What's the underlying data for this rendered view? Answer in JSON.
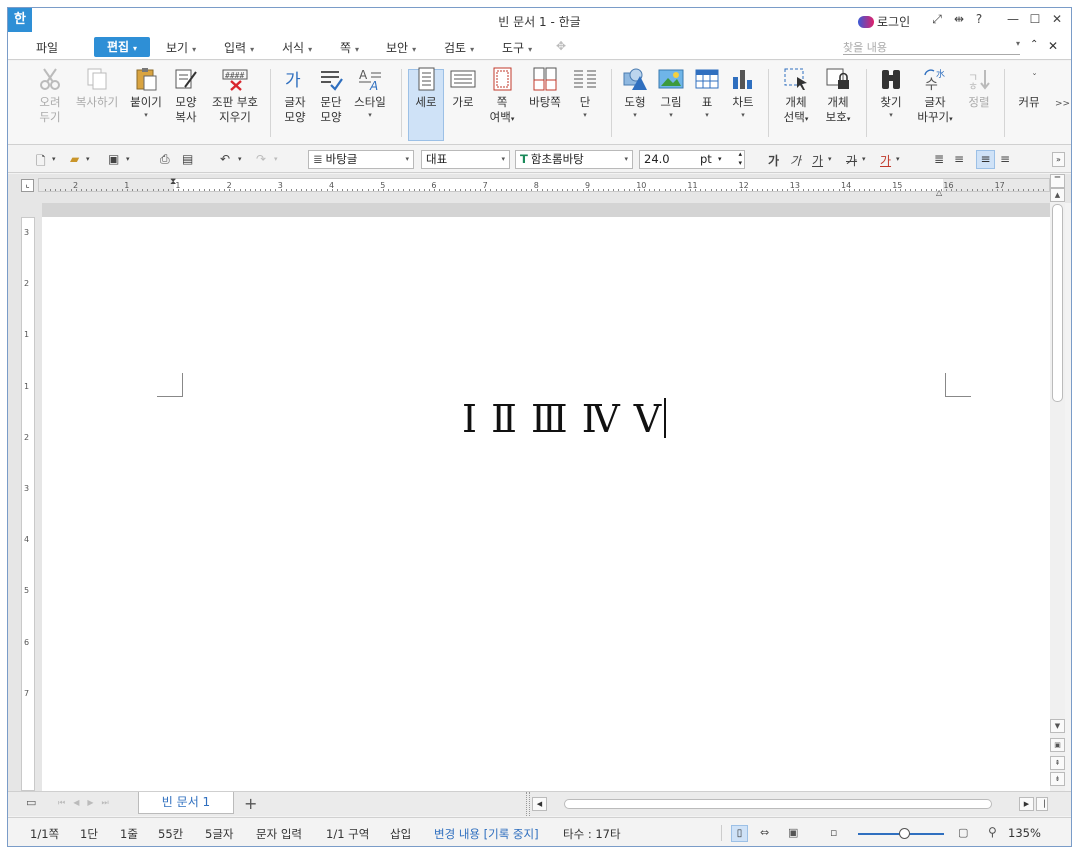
{
  "titlebar": {
    "logo": "한",
    "title": "빈 문서 1 - 한글",
    "login": "로그인",
    "help": "?"
  },
  "menubar": {
    "items": [
      "파일",
      "편집",
      "보기",
      "입력",
      "서식",
      "쪽",
      "보안",
      "검토",
      "도구"
    ],
    "active": "편집",
    "find_placeholder": "찾을 내용"
  },
  "ribbon": {
    "cut": [
      "오려",
      "두기"
    ],
    "copy": "복사하기",
    "paste": "붙이기",
    "format_copy": [
      "모양",
      "복사"
    ],
    "clear_layout": [
      "조판 부호",
      "지우기"
    ],
    "char_shape": [
      "글자",
      "모양"
    ],
    "para_shape": [
      "문단",
      "모양"
    ],
    "style": "스타일",
    "vertical": "세로",
    "horizontal": "가로",
    "page_margin": [
      "쪽",
      "여백"
    ],
    "master_page": "바탕쪽",
    "column": "단",
    "shape": "도형",
    "picture": "그림",
    "table": "표",
    "chart": "차트",
    "obj_select": [
      "개체",
      "선택"
    ],
    "obj_protect": [
      "개체",
      "보호"
    ],
    "find": "찾기",
    "replace_char": [
      "글자",
      "바꾸기"
    ],
    "sort": "정렬",
    "custom": "커뮤",
    "more": ">>"
  },
  "toolbar": {
    "style_combo": "바탕글",
    "lang_combo": "대표",
    "font_combo": "함초롬바탕",
    "font_size": "24.0",
    "font_unit": "pt",
    "bold": "가",
    "italic": "가",
    "underline": "가",
    "strike": "가",
    "color": "가"
  },
  "ruler": {
    "h_numbers": [
      "2",
      "1",
      "1",
      "2",
      "3",
      "4",
      "5",
      "6",
      "7",
      "8",
      "9",
      "10",
      "11",
      "12",
      "13",
      "14",
      "15",
      "16",
      "17"
    ],
    "v_numbers": [
      "3",
      "2",
      "1",
      "1",
      "2",
      "3",
      "4",
      "5",
      "6",
      "7"
    ]
  },
  "document": {
    "text": "Ⅰ Ⅱ Ⅲ Ⅳ Ⅴ"
  },
  "tabs": {
    "doc_tab": "빈 문서 1",
    "add_tab": "+"
  },
  "status": {
    "page": "1/1쪽",
    "column": "1단",
    "line": "1줄",
    "col_pos": "55칸",
    "chars": "5글자",
    "input_mode": "문자 입력",
    "section": "1/1 구역",
    "insert": "삽입",
    "track_changes": "변경 내용 [기록 중지]",
    "keystrokes": "타수 : 17타",
    "zoom": "135%"
  },
  "colors": {
    "accent": "#2e8fd6",
    "track_changes": "#2f6fbf"
  }
}
